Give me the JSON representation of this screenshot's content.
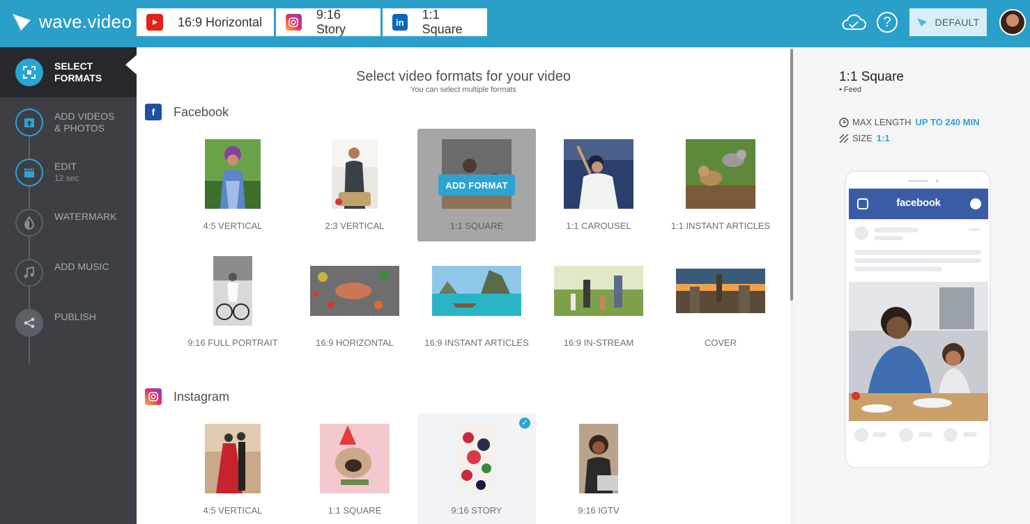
{
  "app": {
    "name": "wave.video"
  },
  "tabs": [
    {
      "label": "16:9 Horizontal",
      "icon": "youtube-icon"
    },
    {
      "label": "9:16 Story",
      "icon": "instagram-icon"
    },
    {
      "label": "1:1 Square",
      "icon": "linkedin-icon"
    }
  ],
  "header": {
    "default_label": "DEFAULT",
    "help_symbol": "?"
  },
  "sidebar": {
    "steps": [
      {
        "label": "SELECT FORMATS",
        "line1": "SELECT",
        "line2": "FORMATS",
        "state": "active",
        "icon": "frame-icon"
      },
      {
        "label": "ADD VIDEOS & PHOTOS",
        "line1": "ADD VIDEOS",
        "line2": "& PHOTOS",
        "state": "done",
        "icon": "upload-icon"
      },
      {
        "label": "EDIT",
        "line1": "EDIT",
        "sub": "12 sec",
        "icon": "clapper-icon"
      },
      {
        "label": "WATERMARK",
        "line1": "WATERMARK",
        "icon": "drop-icon"
      },
      {
        "label": "ADD MUSIC",
        "line1": "ADD MUSIC",
        "icon": "music-icon"
      },
      {
        "label": "PUBLISH",
        "line1": "PUBLISH",
        "icon": "share-icon"
      }
    ]
  },
  "main": {
    "title": "Select video formats for your video",
    "subtitle": "You can select multiple formats",
    "add_format_label": "ADD FORMAT",
    "check_symbol": "✓",
    "sections": [
      {
        "name": "Facebook",
        "icon_letter": "f",
        "formats": [
          "4:5 VERTICAL",
          "2:3 VERTICAL",
          "1:1 SQUARE",
          "1:1 CAROUSEL",
          "1:1 INSTANT ARTICLES",
          "9:16 FULL PORTRAIT",
          "16:9 HORIZONTAL",
          "16:9 INSTANT ARTICLES",
          "16:9 IN-STREAM",
          "COVER"
        ]
      },
      {
        "name": "Instagram",
        "formats": [
          "4:5 VERTICAL",
          "1:1 SQUARE",
          "9:16 STORY",
          "9:16 IGTV"
        ]
      }
    ]
  },
  "preview": {
    "title": "1:1 Square",
    "feed": "• Feed",
    "max_length_label": "MAX LENGTH",
    "max_length_value": "UP TO 240 MIN",
    "size_label": "SIZE",
    "size_value": "1:1",
    "app_name": "facebook"
  },
  "colors": {
    "accent": "#2aa5d3",
    "topbar": "#2a9fc9",
    "sidebar": "#3d3f45",
    "facebook": "#3a5ba6"
  }
}
